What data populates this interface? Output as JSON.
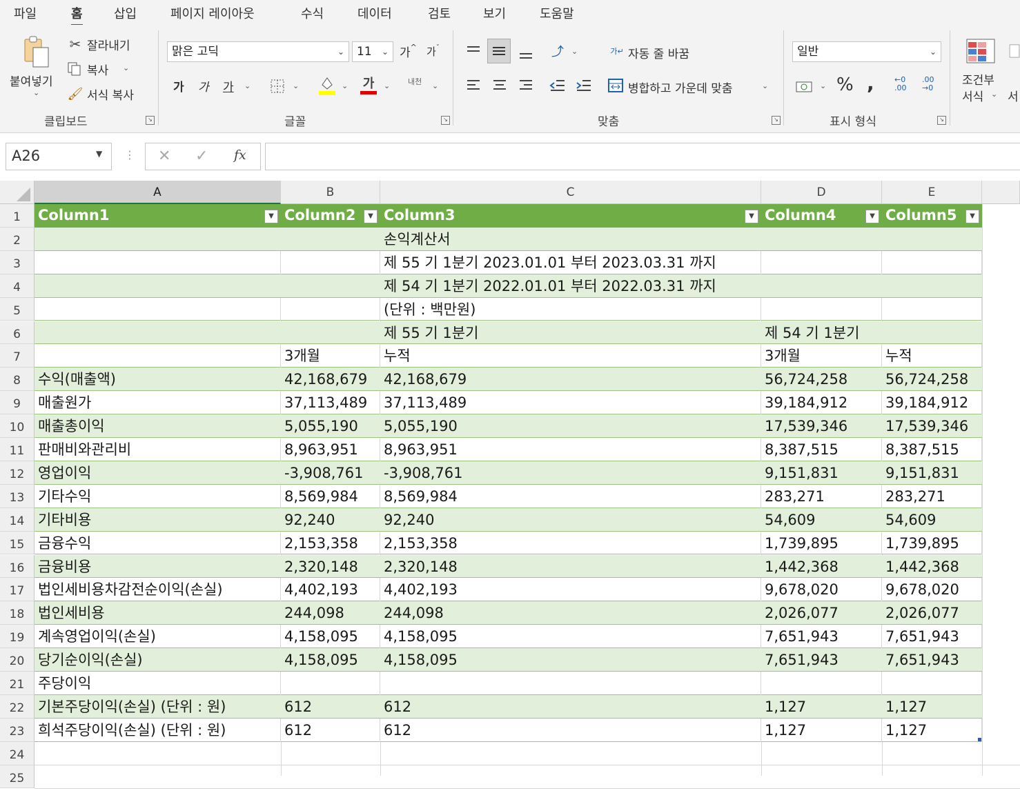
{
  "menu": [
    "파일",
    "홈",
    "삽입",
    "페이지 레이아웃",
    "수식",
    "데이터",
    "검토",
    "보기",
    "도움말"
  ],
  "ribbon": {
    "clipboard": {
      "paste": "붙여넣기",
      "cut": "잘라내기",
      "copy": "복사",
      "format_painter": "서식 복사",
      "group": "클립보드"
    },
    "font": {
      "name": "맑은 고딕",
      "size": "11",
      "grow": "가",
      "shrink": "가",
      "bold": "가",
      "italic": "가",
      "underline": "가",
      "color_glyph": "가",
      "phonetic": "내천",
      "group": "글꼴",
      "fill_color": "#ffff00",
      "font_color": "#e00000"
    },
    "alignment": {
      "wrap": "자동 줄 바꿈",
      "merge": "병합하고 가운데 맞춤",
      "group": "맞춤"
    },
    "number": {
      "format": "일반",
      "group": "표시 형식"
    },
    "styles": {
      "conditional_line1": "조건부",
      "conditional_line2": "서식",
      "next": "서"
    }
  },
  "formula_bar": {
    "name_box": "A26",
    "fx": "fx",
    "content": ""
  },
  "sheet": {
    "columns": [
      "A",
      "B",
      "C",
      "D",
      "E"
    ],
    "header_row": [
      "Column1",
      "Column2",
      "Column3",
      "Column4",
      "Column5"
    ],
    "rows": [
      [
        "",
        "",
        "손익계산서",
        "",
        ""
      ],
      [
        "",
        "",
        "제 55 기 1분기 2023.01.01 부터 2023.03.31 까지",
        "",
        ""
      ],
      [
        "",
        "",
        "제 54 기 1분기 2022.01.01 부터 2022.03.31 까지",
        "",
        ""
      ],
      [
        "",
        "",
        "(단위 : 백만원)",
        "",
        ""
      ],
      [
        "",
        "",
        "제 55 기 1분기",
        "제 54 기 1분기",
        ""
      ],
      [
        "",
        "3개월",
        "누적",
        "3개월",
        "누적"
      ],
      [
        "수익(매출액)",
        "42,168,679",
        "42,168,679",
        "56,724,258",
        "56,724,258"
      ],
      [
        "매출원가",
        "37,113,489",
        "37,113,489",
        "39,184,912",
        "39,184,912"
      ],
      [
        "매출총이익",
        "5,055,190",
        "5,055,190",
        "17,539,346",
        "17,539,346"
      ],
      [
        "판매비와관리비",
        "8,963,951",
        "8,963,951",
        "8,387,515",
        "8,387,515"
      ],
      [
        "영업이익",
        "-3,908,761",
        "-3,908,761",
        "9,151,831",
        "9,151,831"
      ],
      [
        "기타수익",
        "8,569,984",
        "8,569,984",
        "283,271",
        "283,271"
      ],
      [
        "기타비용",
        "92,240",
        "92,240",
        "54,609",
        "54,609"
      ],
      [
        "금융수익",
        "2,153,358",
        "2,153,358",
        "1,739,895",
        "1,739,895"
      ],
      [
        "금융비용",
        "2,320,148",
        "2,320,148",
        "1,442,368",
        "1,442,368"
      ],
      [
        "법인세비용차감전순이익(손실)",
        "4,402,193",
        "4,402,193",
        "9,678,020",
        "9,678,020"
      ],
      [
        "법인세비용",
        "244,098",
        "244,098",
        "2,026,077",
        "2,026,077"
      ],
      [
        "계속영업이익(손실)",
        "4,158,095",
        "4,158,095",
        "7,651,943",
        "7,651,943"
      ],
      [
        "당기순이익(손실)",
        "4,158,095",
        "4,158,095",
        "7,651,943",
        "7,651,943"
      ],
      [
        "주당이익",
        "",
        "",
        "",
        ""
      ],
      [
        "기본주당이익(손실) (단위 : 원)",
        "612",
        "612",
        "1,127",
        "1,127"
      ],
      [
        "희석주당이익(손실) (단위 : 원)",
        "612",
        "612",
        "1,127",
        "1,127"
      ]
    ],
    "row_numbers": [
      "1",
      "2",
      "3",
      "4",
      "5",
      "6",
      "7",
      "8",
      "9",
      "10",
      "11",
      "12",
      "13",
      "14",
      "15",
      "16",
      "17",
      "18",
      "19",
      "20",
      "21",
      "22",
      "23",
      "24",
      "25"
    ],
    "colors": {
      "table_header": "#70ad47",
      "band": "#e2efda",
      "band_line": "#9bc47e",
      "accent": "#217346"
    }
  }
}
